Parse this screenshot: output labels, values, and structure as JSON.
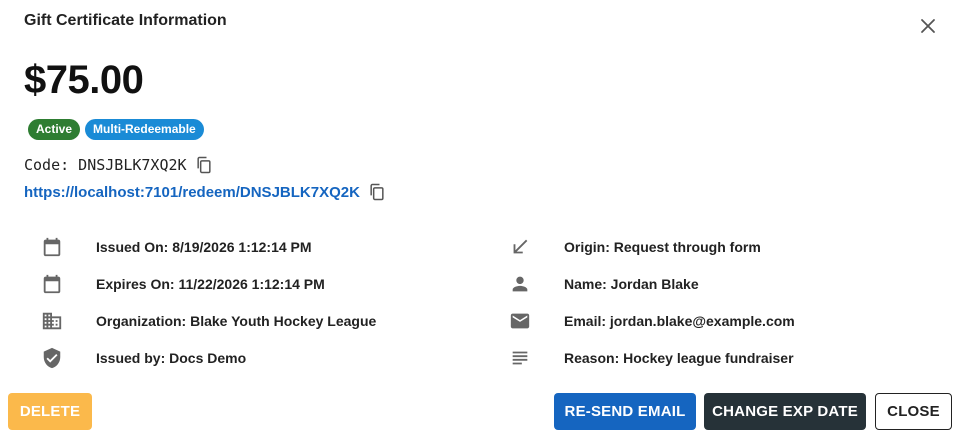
{
  "dialog": {
    "title": "Gift Certificate Information",
    "amount": "$75.00",
    "badges": [
      {
        "label": "Active",
        "color": "#2e7d32"
      },
      {
        "label": "Multi-Redeemable",
        "color": "#1a8bd6"
      }
    ],
    "code_label": "Code: DNSJBLK7XQ2K",
    "redeem_url": "https://localhost:7101/redeem/DNSJBLK7XQ2K"
  },
  "details": {
    "left": [
      {
        "icon": "calendar-icon",
        "text": "Issued On: 8/19/2026 1:12:14 PM"
      },
      {
        "icon": "calendar-icon",
        "text": "Expires On: 11/22/2026 1:12:14 PM"
      },
      {
        "icon": "building-icon",
        "text": "Organization: Blake Youth Hockey League"
      },
      {
        "icon": "shield-check-icon",
        "text": "Issued by: Docs Demo"
      }
    ],
    "right": [
      {
        "icon": "arrow-south-west-icon",
        "text": "Origin: Request through form"
      },
      {
        "icon": "person-icon",
        "text": "Name: Jordan Blake"
      },
      {
        "icon": "mail-icon",
        "text": "Email: jordan.blake@example.com"
      },
      {
        "icon": "subject-lines-icon",
        "text": "Reason: Hockey league fundraiser"
      }
    ]
  },
  "actions": {
    "delete": "DELETE",
    "resend": "RE-SEND EMAIL",
    "change_exp": "CHANGE EXP DATE",
    "close": "CLOSE"
  },
  "colors": {
    "primary": "#1565c0",
    "dark": "#263238",
    "warning": "#fbb94b",
    "icon": "#666666"
  }
}
